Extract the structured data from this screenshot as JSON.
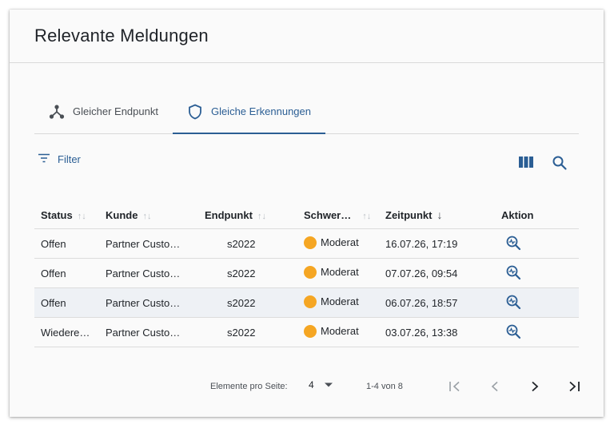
{
  "dialog": {
    "title": "Relevante Meldungen"
  },
  "tabs": [
    {
      "label": "Gleicher Endpunkt",
      "icon": "hub-icon",
      "active": false
    },
    {
      "label": "Gleiche Erkennungen",
      "icon": "shield-icon",
      "active": true
    }
  ],
  "toolbar": {
    "filter_label": "Filter",
    "columns_icon": "columns-icon",
    "search_icon": "search-icon"
  },
  "table": {
    "columns": [
      "Status",
      "Kunde",
      "Endpunkt",
      "Schwer…",
      "Zeitpunkt",
      "Aktion"
    ],
    "rows": [
      {
        "status": "Offen",
        "kunde": "Partner Custo…",
        "endpunkt": "s2022",
        "schwere": "Moderat",
        "zeitpunkt": "16.07.26, 17:19"
      },
      {
        "status": "Offen",
        "kunde": "Partner Custo…",
        "endpunkt": "s2022",
        "schwere": "Moderat",
        "zeitpunkt": "07.07.26, 09:54"
      },
      {
        "status": "Offen",
        "kunde": "Partner Custo…",
        "endpunkt": "s2022",
        "schwere": "Moderat",
        "zeitpunkt": "06.07.26, 18:57"
      },
      {
        "status": "Wiedere…",
        "kunde": "Partner Custo…",
        "endpunkt": "s2022",
        "schwere": "Moderat",
        "zeitpunkt": "03.07.26, 13:38"
      }
    ]
  },
  "pagination": {
    "label": "Elemente pro Seite:",
    "page_size": "4",
    "range": "1-4 von 8"
  },
  "colors": {
    "accent": "#2b5e94",
    "moderate": "#f5a623"
  }
}
